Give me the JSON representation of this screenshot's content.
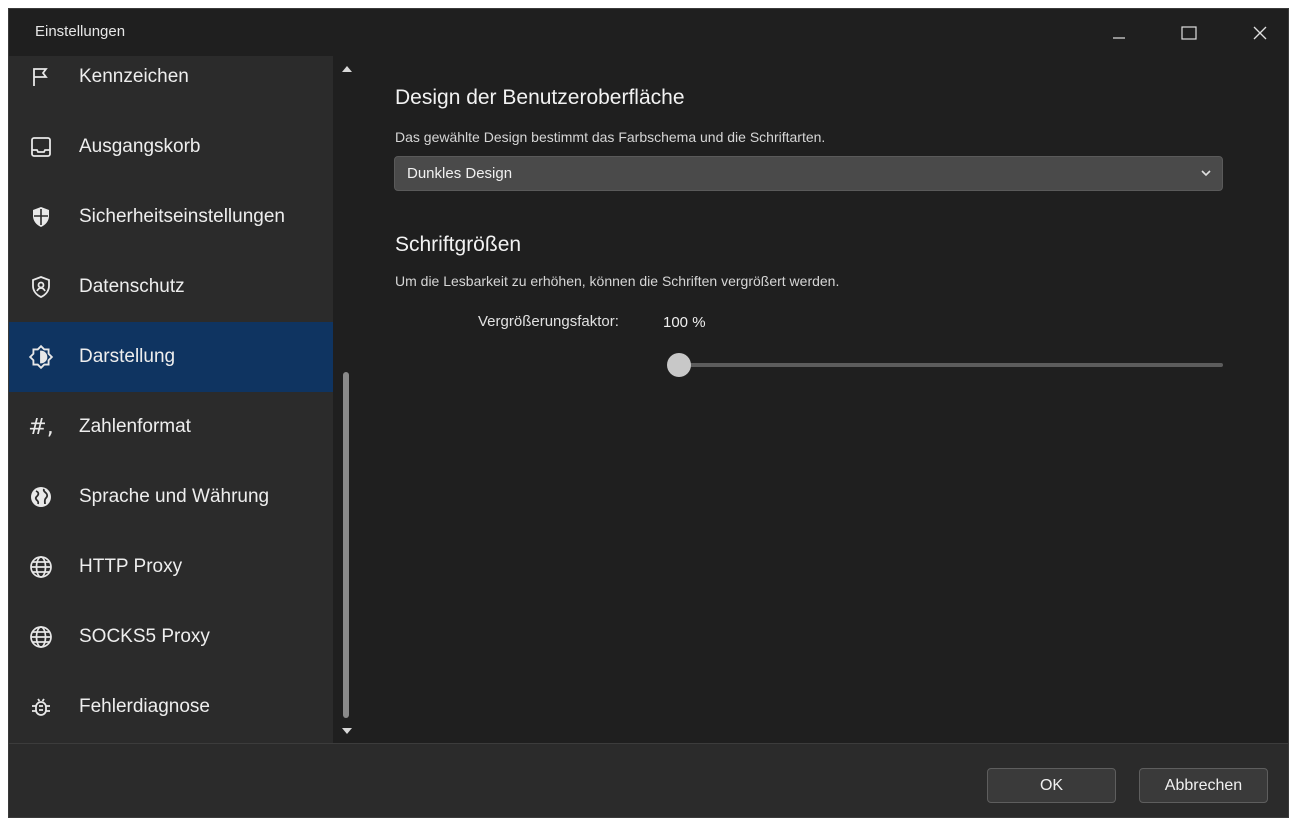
{
  "window": {
    "title": "Einstellungen",
    "controls": [
      "minimize-icon",
      "maximize-icon",
      "close-icon"
    ]
  },
  "sidebar": {
    "items": [
      {
        "label": "Kennzeichen",
        "icon": "flag-icon",
        "active": false
      },
      {
        "label": "Ausgangskorb",
        "icon": "outbox-icon",
        "active": false
      },
      {
        "label": "Sicherheitseinstellungen",
        "icon": "shield-icon",
        "active": false
      },
      {
        "label": "Datenschutz",
        "icon": "privacy-shield-icon",
        "active": false
      },
      {
        "label": "Darstellung",
        "icon": "appearance-icon",
        "active": true
      },
      {
        "label": "Zahlenformat",
        "icon": "number-format-icon",
        "active": false
      },
      {
        "label": "Sprache und Währung",
        "icon": "globe-icon",
        "active": false
      },
      {
        "label": "HTTP Proxy",
        "icon": "network-globe-icon",
        "active": false
      },
      {
        "label": "SOCKS5 Proxy",
        "icon": "network-globe-icon",
        "active": false
      },
      {
        "label": "Fehlerdiagnose",
        "icon": "bug-icon",
        "active": false
      }
    ]
  },
  "main": {
    "design": {
      "title": "Design der Benutzeroberfläche",
      "description": "Das gewählte Design bestimmt das Farbschema und die Schriftarten.",
      "selected": "Dunkles Design"
    },
    "fonts": {
      "title": "Schriftgrößen",
      "description": "Um die Lesbarkeit zu erhöhen, können die Schriften vergrößert werden.",
      "factor_label": "Vergrößerungsfaktor:",
      "factor_value": "100 %",
      "slider_fraction": 0
    }
  },
  "footer": {
    "ok_label": "OK",
    "cancel_label": "Abbrechen"
  },
  "colors": {
    "background": "#1f1f1f",
    "sidebar": "#2b2b2b",
    "active_item": "#0f3461"
  }
}
